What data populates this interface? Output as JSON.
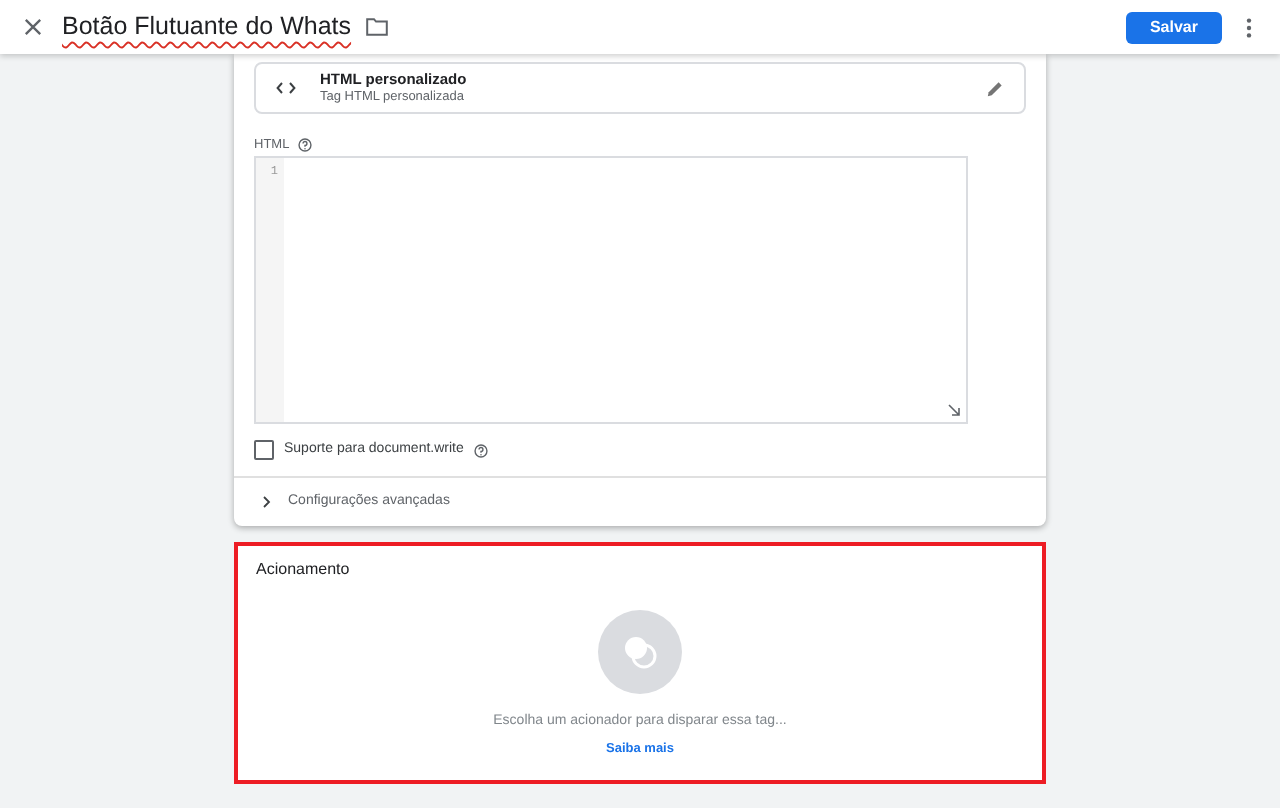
{
  "header": {
    "title": "Botão Flutuante do Whats",
    "save_button": "Salvar"
  },
  "tag_type": {
    "name": "HTML personalizado",
    "subtitle": "Tag HTML personalizada"
  },
  "html_field": {
    "label": "HTML",
    "line_numbers": [
      "1"
    ]
  },
  "document_write": {
    "label": "Suporte para document.write",
    "checked": false
  },
  "advanced": {
    "label": "Configurações avançadas",
    "expanded": false
  },
  "triggering": {
    "title": "Acionamento",
    "highlighted": true,
    "message": "Escolha um acionador para disparar essa tag...",
    "link": "Saiba mais"
  }
}
